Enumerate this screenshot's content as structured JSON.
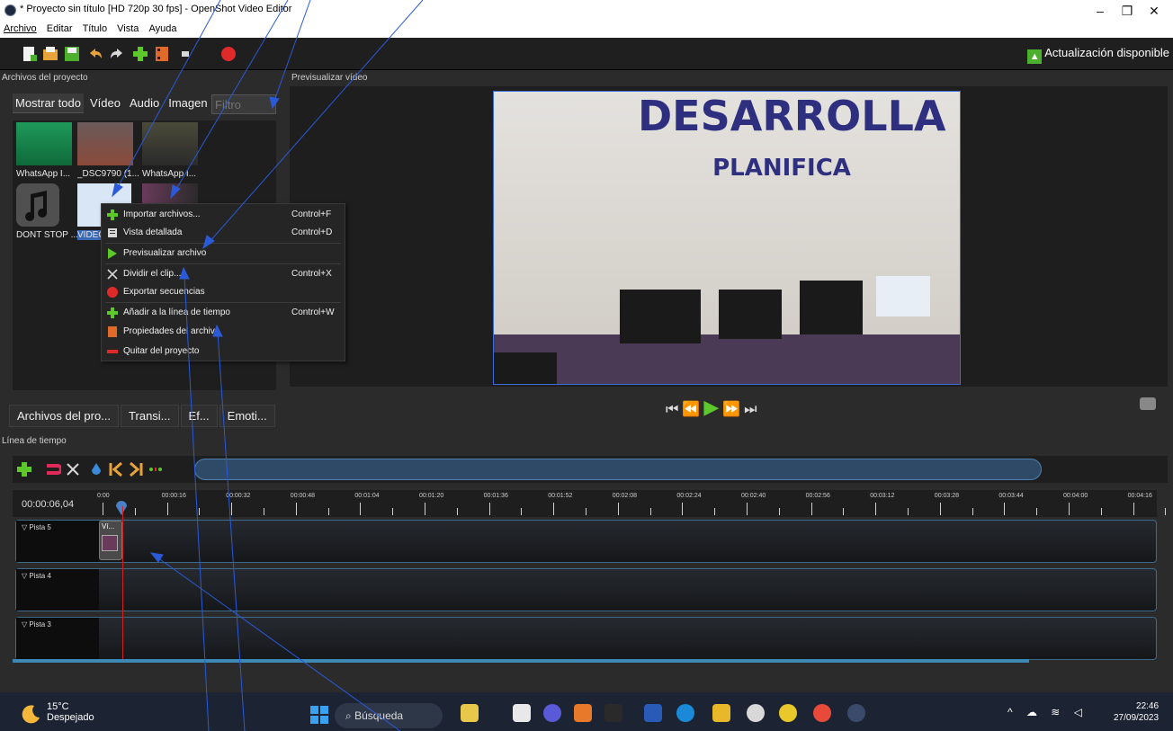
{
  "window": {
    "title": "* Proyecto sin título [HD 720p 30 fps] - OpenShot Video Editor",
    "controls": [
      "–",
      "❐",
      "✕"
    ]
  },
  "menu": [
    "Archivo",
    "Editar",
    "Título",
    "Vista",
    "Ayuda"
  ],
  "toolbar": {
    "icons": [
      "new-project-icon",
      "open-project-icon",
      "save-project-icon",
      "undo-icon",
      "redo-icon",
      "import-files-icon",
      "profile-icon",
      "fullscreen-icon",
      "export-video-icon"
    ],
    "update_label": "Actualización disponible"
  },
  "project_panel": {
    "header": "Archivos del proyecto",
    "tabs": [
      "Mostrar todo",
      "Vídeo",
      "Audio",
      "Imagen"
    ],
    "active_tab": "Mostrar todo",
    "filter_placeholder": "Filtro",
    "files": [
      {
        "label": "WhatsApp I...",
        "color": "#1f9a5a"
      },
      {
        "label": "_DSC9790 (1...",
        "color": "#8a6a5a"
      },
      {
        "label": "WhatsApp I...",
        "color": "#5a4a3a"
      },
      {
        "label": "DONT STOP ...",
        "color": "#3a3a3a"
      },
      {
        "label": "VÍDEO",
        "color": "#d8e6f5"
      },
      {
        "label": "",
        "color": "#6a3a5a"
      }
    ],
    "bottom_tabs": [
      "Archivos del pro...",
      "Transi...",
      "Ef...",
      "Emoti..."
    ]
  },
  "context_menu": {
    "items": [
      {
        "label": "Importar archivos...",
        "shortcut": "Control+F",
        "icon": "plus-icon"
      },
      {
        "label": "Vista detallada",
        "shortcut": "Control+D",
        "icon": "details-icon"
      },
      {
        "label": "Previsualizar archivo",
        "shortcut": "",
        "icon": "play-icon"
      },
      {
        "label": "Dividir el clip...",
        "shortcut": "Control+X",
        "icon": "scissors-icon"
      },
      {
        "label": "Exportar secuencias",
        "shortcut": "",
        "icon": "record-icon"
      },
      {
        "label": "Añadir a la línea de tiempo",
        "shortcut": "Control+W",
        "icon": "plus-icon"
      },
      {
        "label": "Propiedades del archivo",
        "shortcut": "",
        "icon": "properties-icon"
      },
      {
        "label": "Quitar del proyecto",
        "shortcut": "",
        "icon": "remove-icon"
      }
    ]
  },
  "preview": {
    "header": "Previsualizar vídeo",
    "frame_text_line1": "DESARROLLA",
    "frame_text_line2": "PLANIFICA",
    "transport": [
      "⏮",
      "⏪",
      "▶",
      "⏩",
      "⏭"
    ]
  },
  "timeline": {
    "header": "Línea de tiempo",
    "current_time": "00:00:06,04",
    "ticks": [
      "0:00",
      "00:00:16",
      "00:00:32",
      "00:00:48",
      "00:01:04",
      "00:01:20",
      "00:01:36",
      "00:01:52",
      "00:02:08",
      "00:02:24",
      "00:02:40",
      "00:02:56",
      "00:03:12",
      "00:03:28",
      "00:03:44",
      "00:04:00",
      "00:04:16"
    ],
    "tracks": [
      "Pista 5",
      "Pista 4",
      "Pista 3"
    ],
    "clip_label": "Ví..."
  },
  "taskbar": {
    "weather_temp": "15°C",
    "weather_desc": "Despejado",
    "search_label": "Búsqueda",
    "time": "22:46",
    "date": "27/09/2023"
  }
}
